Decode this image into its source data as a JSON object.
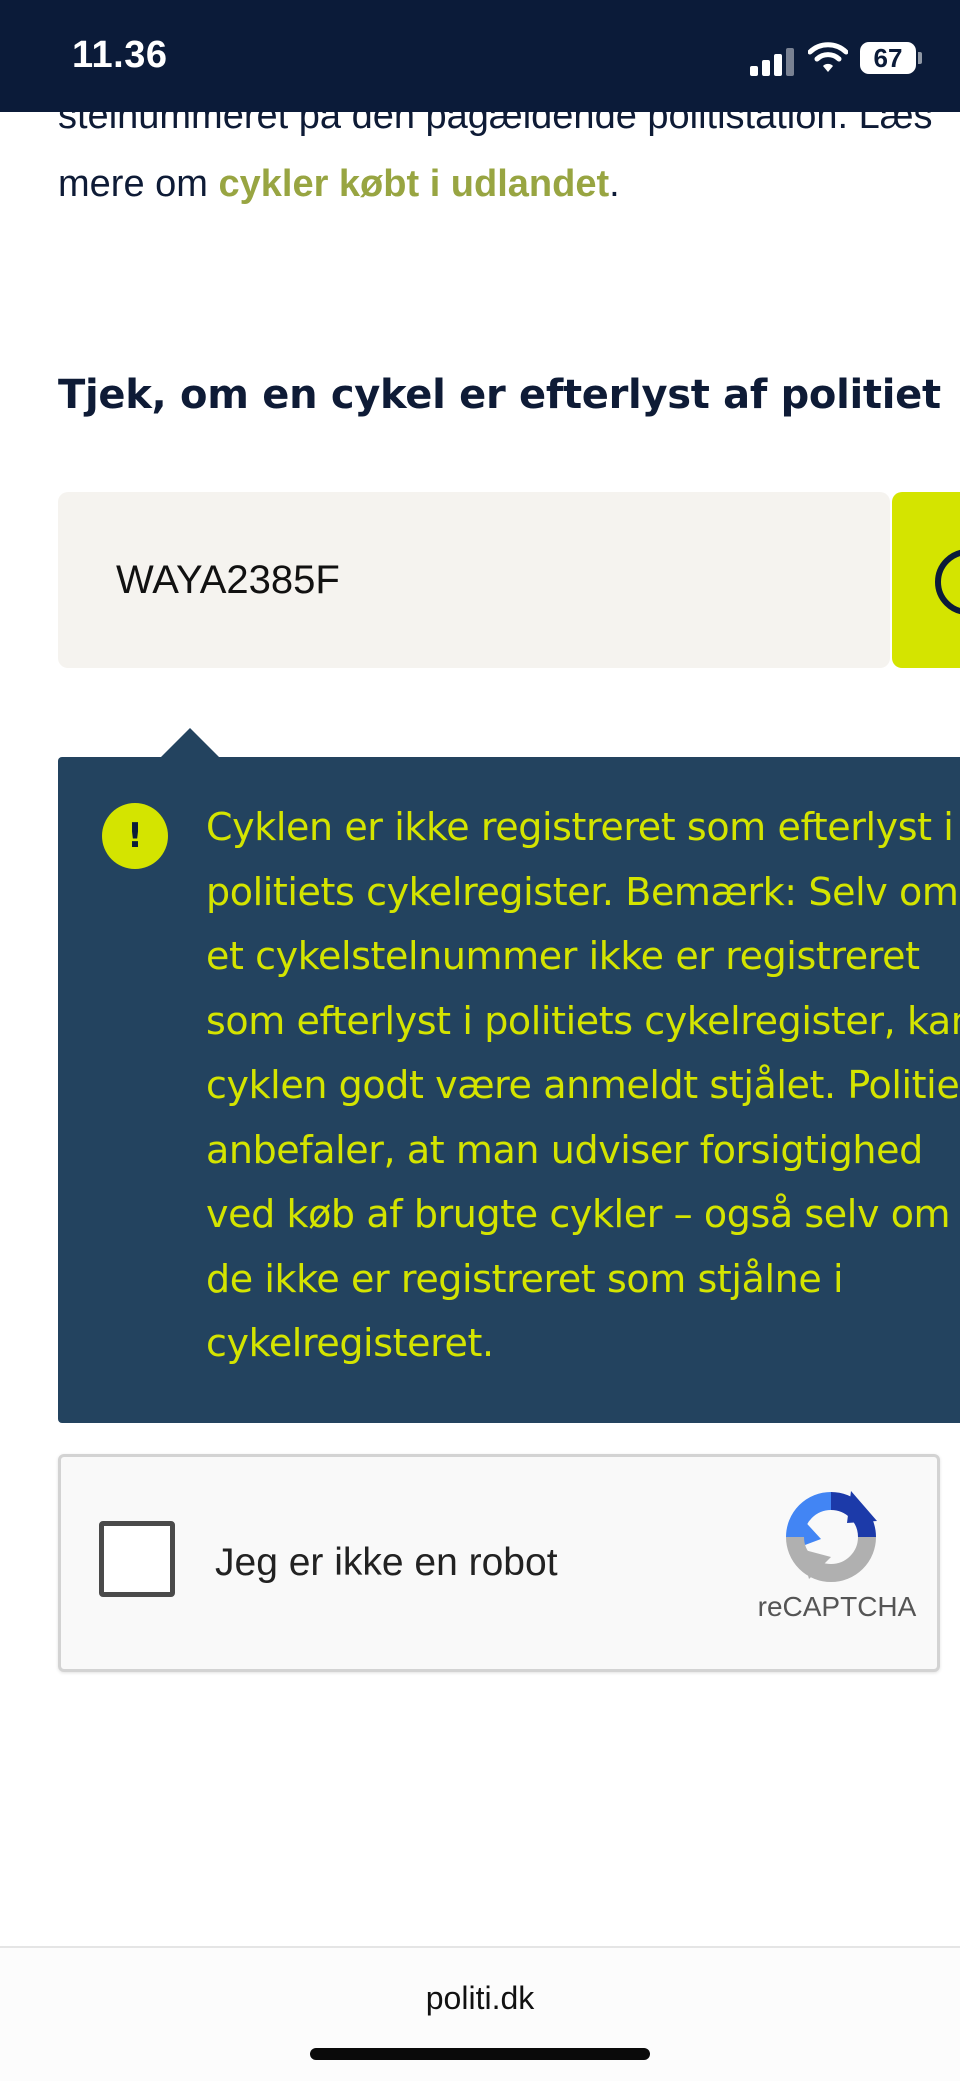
{
  "status_bar": {
    "time": "11.36",
    "battery": "67",
    "icons": [
      "signal-icon",
      "wifi-icon",
      "battery-icon"
    ]
  },
  "article": {
    "line1_text": "stelnummeret på den pågældende politistation. Læs",
    "line2_prefix": "mere om ",
    "line2_link": "cykler købt i udlandet",
    "line2_suffix": "."
  },
  "bike_check": {
    "heading": "Tjek, om en cykel er efterlyst af politiet",
    "input_value": "WAYA2385F",
    "search_icon": "search-icon",
    "accent_color": "#d4e400"
  },
  "result": {
    "icon": "exclamation-icon",
    "message": "Cyklen er ikke registreret som efterlyst i\npolitiets cykelregister. Bemærk: Selv om\net cykelstelnummer ikke er registreret\nsom efterlyst i politiets cykelregister, kan\ncyklen godt være anmeldt stjålet. Politiet\nanbefaler, at man udviser forsigtighed\nved køb af brugte cykler – også selv om\nde ikke er registreret som stjålne i\ncykelregisteret.",
    "background_color": "#23435f",
    "text_color": "#d4e400"
  },
  "recaptcha": {
    "label": "Jeg er ikke en robot",
    "brand": "reCAPTCHA",
    "checked": false
  },
  "browser": {
    "url": "politi.dk"
  }
}
